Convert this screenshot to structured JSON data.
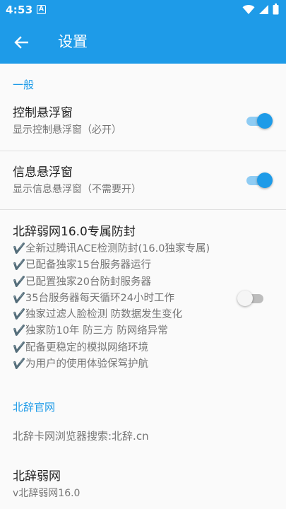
{
  "status_bar": {
    "time": "4:53",
    "notif_glyph": "A"
  },
  "toolbar": {
    "title": "设置",
    "back_icon": "arrow-left-icon"
  },
  "section_general": {
    "header": "一般"
  },
  "pref_control": {
    "title": "控制悬浮窗",
    "summary": "显示控制悬浮窗（必开）",
    "enabled": true
  },
  "pref_info": {
    "title": "信息悬浮窗",
    "summary": "显示信息悬浮窗（不需要开）",
    "enabled": true
  },
  "pref_weaknet": {
    "title": "北辞弱网16.0专属防封",
    "enabled": false,
    "lines": [
      "✔️全新过腾讯ACE检测防封(16.0独家专属)",
      "✔️已配备独家15台服务器运行",
      "✔️已配置独家20台防封服务器",
      "✔️35台服务器每天循环24小时工作",
      "✔️独家过滤人脸检测 防数据发生变化",
      "✔️独家防10年 防三方 防网络异常",
      "✔️配备更稳定的模拟网络环境",
      "✔️为用户的使用体验保驾护航"
    ]
  },
  "section_official": {
    "header": "北辞官网"
  },
  "pref_browser": {
    "title": "北辞卡网浏览器搜索:北辞.cn"
  },
  "pref_about": {
    "title": "北辞弱网",
    "summary": "v北辞弱网16.0"
  },
  "colors": {
    "accent": "#1e9be8",
    "text_primary": "#212121",
    "text_secondary": "#757575"
  }
}
